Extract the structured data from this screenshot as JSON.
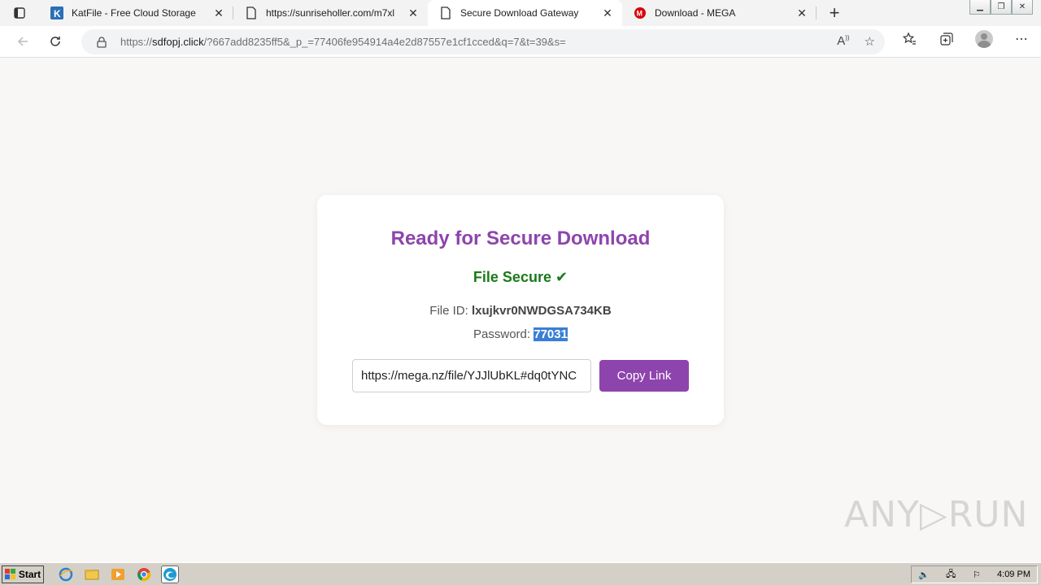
{
  "tabs": [
    {
      "title": "KatFile - Free Cloud Storage",
      "favicon": "katfile-icon",
      "active": false
    },
    {
      "title": "https://sunriseholler.com/m7xl",
      "favicon": "page-icon",
      "active": false
    },
    {
      "title": "Secure Download Gateway",
      "favicon": "page-icon",
      "active": true
    },
    {
      "title": "Download - MEGA",
      "favicon": "mega-icon",
      "active": false
    }
  ],
  "address": {
    "prefix": "https://",
    "host": "sdfopj.click",
    "rest": "/?667add8235ff5&_p_=77406fe954914a4e2d87557e1cf1cced&q=7&t=39&s="
  },
  "page": {
    "heading": "Ready for Secure Download",
    "status": "File Secure ✔",
    "file_id_label": "File ID:",
    "file_id": "lxujkvr0NWDGSA734KB",
    "password_label": "Password:",
    "password": "77031",
    "link_value": "https://mega.nz/file/YJJlUbKL#dq0tYNC",
    "copy_label": "Copy Link"
  },
  "watermark": "ANY▷RUN",
  "taskbar": {
    "start_label": "Start",
    "clock": "4:09 PM"
  },
  "colors": {
    "accent": "#8e44ad",
    "secure_green": "#1a7a1a",
    "selection": "#3a7fd5"
  }
}
